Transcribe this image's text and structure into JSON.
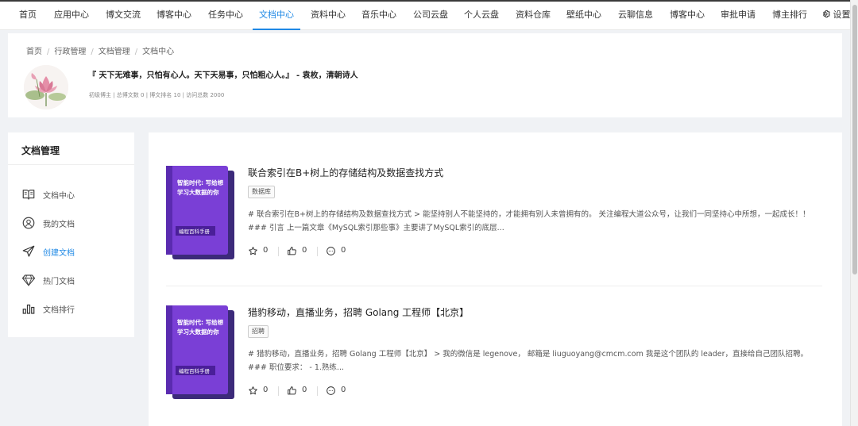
{
  "nav": {
    "items": [
      "首页",
      "应用中心",
      "博文交流",
      "博客中心",
      "任务中心",
      "文档中心",
      "资料中心",
      "音乐中心",
      "公司云盘",
      "个人云盘",
      "资料仓库",
      "壁纸中心",
      "云聊信息",
      "博客中心",
      "审批申请",
      "博主排行"
    ],
    "active_index": 5,
    "settings_label": "设置",
    "accent_color": "#1e88e5"
  },
  "breadcrumb": [
    "首页",
    "行政管理",
    "文档管理",
    "文档中心"
  ],
  "profile": {
    "quote": "『 天下无难事，只怕有心人。天下天易事，只怕粗心人。』 - 袁枚，清朝诗人",
    "stats": "初级博主 | 总博文数 0 | 博文排名 10 | 访问总数 2000"
  },
  "sidebar": {
    "title": "文档管理",
    "items": [
      {
        "label": "文档中心",
        "icon": "book-icon"
      },
      {
        "label": "我的文档",
        "icon": "user-circle-icon"
      },
      {
        "label": "创建文档",
        "icon": "send-icon"
      },
      {
        "label": "热门文档",
        "icon": "diamond-icon"
      },
      {
        "label": "文档排行",
        "icon": "bar-chart-icon"
      }
    ],
    "active_index": 2
  },
  "cover": {
    "line1": "智能时代: 写给想",
    "line2": "学习大数据的你",
    "footer": "编程百科手册"
  },
  "articles": [
    {
      "title": "联合索引在B+树上的存储结构及数据查找方式",
      "tag": "数据库",
      "excerpt": "# 联合索引在B+树上的存储结构及数据查找方式 > 能坚持别人不能坚持的，才能拥有别人未曾拥有的。 关注编程大道公众号，让我们一同坚持心中所想，一起成长！！ ### 引言 上一篇文章《MySQL索引那些事》主要讲了MySQL索引的底层...",
      "stars": "0",
      "likes": "0",
      "comments": "0"
    },
    {
      "title": "猎豹移动，直播业务，招聘 Golang 工程师【北京】",
      "tag": "招聘",
      "excerpt": "# 猎豹移动，直播业务，招聘 Golang 工程师【北京】 > 我的微信是 legenove， 邮箱是 liuguoyang@cmcm.com 我是这个团队的 leader，直接给自己团队招聘。 ### 职位要求： - 1.熟练...",
      "stars": "0",
      "likes": "0",
      "comments": "0"
    }
  ]
}
